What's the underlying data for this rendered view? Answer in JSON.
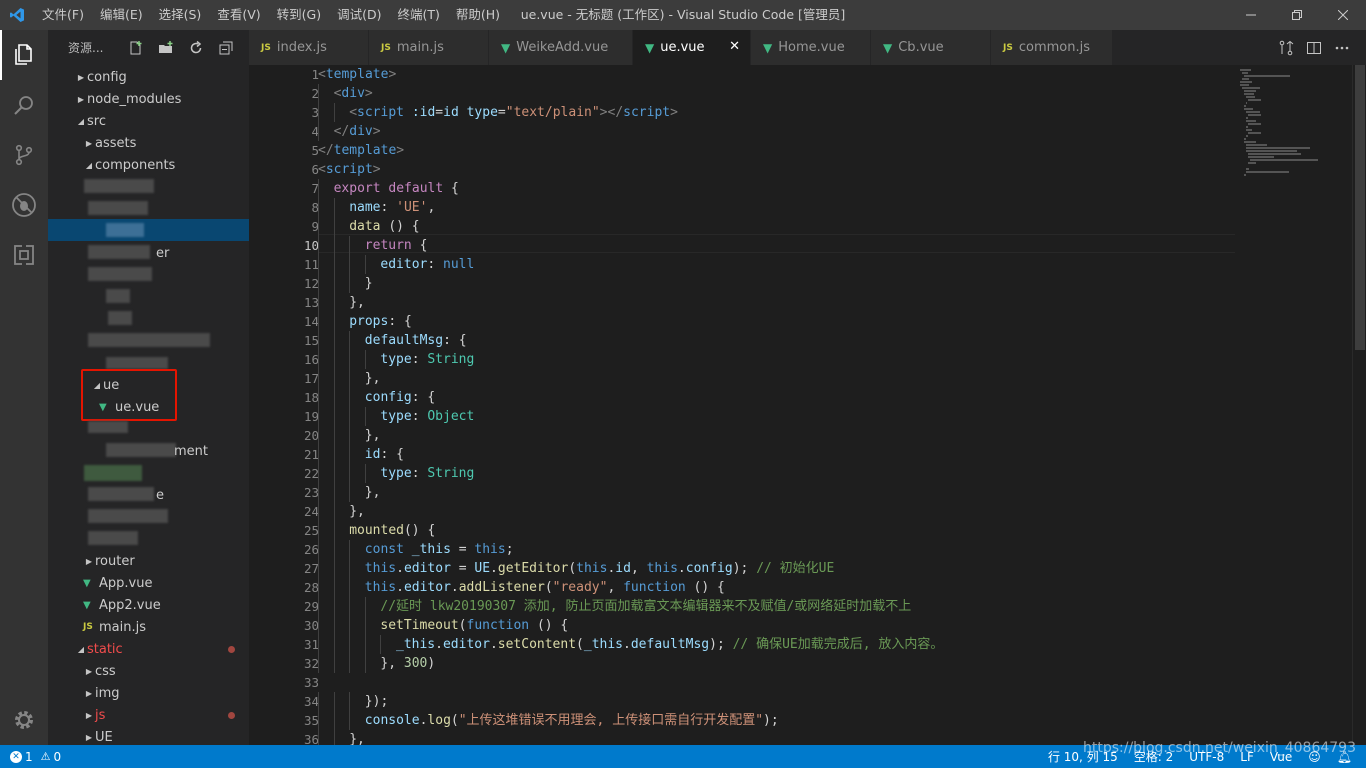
{
  "titlebar": {
    "title": "ue.vue - 无标题 (工作区) - Visual Studio Code [管理员]",
    "menus": [
      "文件(F)",
      "编辑(E)",
      "选择(S)",
      "查看(V)",
      "转到(G)",
      "调试(D)",
      "终端(T)",
      "帮助(H)"
    ]
  },
  "sidebar": {
    "title": "资源...",
    "tree": [
      {
        "label": "config",
        "type": "folder",
        "open": false
      },
      {
        "label": "node_modules",
        "type": "folder",
        "open": false
      },
      {
        "label": "src",
        "type": "folder",
        "open": true
      },
      {
        "label": "assets",
        "type": "folder",
        "open": false
      },
      {
        "label": "components",
        "type": "folder",
        "open": true
      },
      {
        "label": "ue",
        "type": "folder",
        "open": true
      },
      {
        "label": "ue.vue",
        "type": "vue"
      },
      {
        "label": "router",
        "type": "folder",
        "open": false
      },
      {
        "label": "App.vue",
        "type": "vue"
      },
      {
        "label": "App2.vue",
        "type": "vue"
      },
      {
        "label": "main.js",
        "type": "js"
      },
      {
        "label": "static",
        "type": "folder",
        "open": true,
        "modified": true
      },
      {
        "label": "css",
        "type": "folder",
        "open": false
      },
      {
        "label": "img",
        "type": "folder",
        "open": false
      },
      {
        "label": "js",
        "type": "folder",
        "open": false,
        "modified": true
      },
      {
        "label": "UE",
        "type": "folder",
        "open": false
      }
    ],
    "blur_fragments": [
      "er",
      "ment",
      "e"
    ]
  },
  "tabs": [
    {
      "label": "index.js",
      "type": "js",
      "active": false
    },
    {
      "label": "main.js",
      "type": "js",
      "active": false
    },
    {
      "label": "WeikeAdd.vue",
      "type": "vue",
      "active": false
    },
    {
      "label": "ue.vue",
      "type": "vue",
      "active": true
    },
    {
      "label": "Home.vue",
      "type": "vue",
      "active": false
    },
    {
      "label": "Cb.vue",
      "type": "vue",
      "active": false
    },
    {
      "label": "common.js",
      "type": "js",
      "active": false
    }
  ],
  "editor": {
    "current_line": 10,
    "lines": [
      {
        "n": 1,
        "i": 0,
        "t": [
          [
            "t-punc",
            "<"
          ],
          [
            "t-tag",
            "template"
          ],
          [
            "t-punc",
            ">"
          ]
        ]
      },
      {
        "n": 2,
        "i": 1,
        "t": [
          [
            "t-punc",
            "<"
          ],
          [
            "t-tag",
            "div"
          ],
          [
            "t-punc",
            ">"
          ]
        ]
      },
      {
        "n": 3,
        "i": 2,
        "t": [
          [
            "t-punc",
            "<"
          ],
          [
            "t-tag",
            "script"
          ],
          [
            "t-plain",
            " "
          ],
          [
            "t-attr",
            ":id"
          ],
          [
            "t-plain",
            "="
          ],
          [
            "t-attr",
            "id"
          ],
          [
            "t-plain",
            " "
          ],
          [
            "t-attr",
            "type"
          ],
          [
            "t-plain",
            "="
          ],
          [
            "t-str",
            "\"text/plain\""
          ],
          [
            "t-punc",
            "></"
          ],
          [
            "t-tag",
            "script"
          ],
          [
            "t-punc",
            ">"
          ]
        ]
      },
      {
        "n": 4,
        "i": 1,
        "t": [
          [
            "t-punc",
            "</"
          ],
          [
            "t-tag",
            "div"
          ],
          [
            "t-punc",
            ">"
          ]
        ]
      },
      {
        "n": 5,
        "i": 0,
        "t": [
          [
            "t-punc",
            "</"
          ],
          [
            "t-tag",
            "template"
          ],
          [
            "t-punc",
            ">"
          ]
        ]
      },
      {
        "n": 6,
        "i": 0,
        "t": [
          [
            "t-punc",
            "<"
          ],
          [
            "t-tag",
            "script"
          ],
          [
            "t-punc",
            ">"
          ]
        ]
      },
      {
        "n": 7,
        "i": 1,
        "t": [
          [
            "t-kw",
            "export"
          ],
          [
            "t-plain",
            " "
          ],
          [
            "t-kw",
            "default"
          ],
          [
            "t-plain",
            " {"
          ]
        ]
      },
      {
        "n": 8,
        "i": 2,
        "t": [
          [
            "t-prop",
            "name"
          ],
          [
            "t-plain",
            ": "
          ],
          [
            "t-str",
            "'UE'"
          ],
          [
            "t-plain",
            ","
          ]
        ]
      },
      {
        "n": 9,
        "i": 2,
        "t": [
          [
            "t-fn",
            "data"
          ],
          [
            "t-plain",
            " () {"
          ]
        ]
      },
      {
        "n": 10,
        "i": 3,
        "t": [
          [
            "t-kw",
            "return"
          ],
          [
            "t-plain",
            " {"
          ]
        ]
      },
      {
        "n": 11,
        "i": 4,
        "t": [
          [
            "t-prop",
            "editor"
          ],
          [
            "t-plain",
            ": "
          ],
          [
            "t-key",
            "null"
          ]
        ]
      },
      {
        "n": 12,
        "i": 3,
        "t": [
          [
            "t-plain",
            "}"
          ]
        ]
      },
      {
        "n": 13,
        "i": 2,
        "t": [
          [
            "t-plain",
            "},"
          ]
        ]
      },
      {
        "n": 14,
        "i": 2,
        "t": [
          [
            "t-prop",
            "props"
          ],
          [
            "t-plain",
            ": {"
          ]
        ]
      },
      {
        "n": 15,
        "i": 3,
        "t": [
          [
            "t-prop",
            "defaultMsg"
          ],
          [
            "t-plain",
            ": {"
          ]
        ]
      },
      {
        "n": 16,
        "i": 4,
        "t": [
          [
            "t-prop",
            "type"
          ],
          [
            "t-plain",
            ": "
          ],
          [
            "t-cls",
            "String"
          ]
        ]
      },
      {
        "n": 17,
        "i": 3,
        "t": [
          [
            "t-plain",
            "},"
          ]
        ]
      },
      {
        "n": 18,
        "i": 3,
        "t": [
          [
            "t-prop",
            "config"
          ],
          [
            "t-plain",
            ": {"
          ]
        ]
      },
      {
        "n": 19,
        "i": 4,
        "t": [
          [
            "t-prop",
            "type"
          ],
          [
            "t-plain",
            ": "
          ],
          [
            "t-cls",
            "Object"
          ]
        ]
      },
      {
        "n": 20,
        "i": 3,
        "t": [
          [
            "t-plain",
            "},"
          ]
        ]
      },
      {
        "n": 21,
        "i": 3,
        "t": [
          [
            "t-prop",
            "id"
          ],
          [
            "t-plain",
            ": {"
          ]
        ]
      },
      {
        "n": 22,
        "i": 4,
        "t": [
          [
            "t-prop",
            "type"
          ],
          [
            "t-plain",
            ": "
          ],
          [
            "t-cls",
            "String"
          ]
        ]
      },
      {
        "n": 23,
        "i": 3,
        "t": [
          [
            "t-plain",
            "},"
          ]
        ]
      },
      {
        "n": 24,
        "i": 2,
        "t": [
          [
            "t-plain",
            "},"
          ]
        ]
      },
      {
        "n": 25,
        "i": 2,
        "t": [
          [
            "t-fn",
            "mounted"
          ],
          [
            "t-plain",
            "() {"
          ]
        ]
      },
      {
        "n": 26,
        "i": 3,
        "t": [
          [
            "t-key",
            "const"
          ],
          [
            "t-plain",
            " "
          ],
          [
            "t-prop",
            "_this"
          ],
          [
            "t-plain",
            " = "
          ],
          [
            "t-key",
            "this"
          ],
          [
            "t-plain",
            ";"
          ]
        ]
      },
      {
        "n": 27,
        "i": 3,
        "t": [
          [
            "t-key",
            "this"
          ],
          [
            "t-plain",
            "."
          ],
          [
            "t-prop",
            "editor"
          ],
          [
            "t-plain",
            " = "
          ],
          [
            "t-prop",
            "UE"
          ],
          [
            "t-plain",
            "."
          ],
          [
            "t-fn",
            "getEditor"
          ],
          [
            "t-plain",
            "("
          ],
          [
            "t-key",
            "this"
          ],
          [
            "t-plain",
            "."
          ],
          [
            "t-prop",
            "id"
          ],
          [
            "t-plain",
            ", "
          ],
          [
            "t-key",
            "this"
          ],
          [
            "t-plain",
            "."
          ],
          [
            "t-prop",
            "config"
          ],
          [
            "t-plain",
            "); "
          ],
          [
            "t-cmt",
            "// 初始化UE"
          ]
        ]
      },
      {
        "n": 28,
        "i": 3,
        "t": [
          [
            "t-key",
            "this"
          ],
          [
            "t-plain",
            "."
          ],
          [
            "t-prop",
            "editor"
          ],
          [
            "t-plain",
            "."
          ],
          [
            "t-fn",
            "addListener"
          ],
          [
            "t-plain",
            "("
          ],
          [
            "t-str",
            "\"ready\""
          ],
          [
            "t-plain",
            ", "
          ],
          [
            "t-key",
            "function"
          ],
          [
            "t-plain",
            " () {"
          ]
        ]
      },
      {
        "n": 29,
        "i": 4,
        "t": [
          [
            "t-cmt",
            "//延时 lkw20190307 添加, 防止页面加载富文本编辑器来不及赋值/或网络延时加载不上"
          ]
        ]
      },
      {
        "n": 30,
        "i": 4,
        "t": [
          [
            "t-fn",
            "setTimeout"
          ],
          [
            "t-plain",
            "("
          ],
          [
            "t-key",
            "function"
          ],
          [
            "t-plain",
            " () {"
          ]
        ]
      },
      {
        "n": 31,
        "i": 5,
        "t": [
          [
            "t-prop",
            "_this"
          ],
          [
            "t-plain",
            "."
          ],
          [
            "t-prop",
            "editor"
          ],
          [
            "t-plain",
            "."
          ],
          [
            "t-fn",
            "setContent"
          ],
          [
            "t-plain",
            "("
          ],
          [
            "t-prop",
            "_this"
          ],
          [
            "t-plain",
            "."
          ],
          [
            "t-prop",
            "defaultMsg"
          ],
          [
            "t-plain",
            "); "
          ],
          [
            "t-cmt",
            "// 确保UE加载完成后, 放入内容。"
          ]
        ]
      },
      {
        "n": 32,
        "i": 4,
        "t": [
          [
            "t-plain",
            "}, "
          ],
          [
            "t-num",
            "300"
          ],
          [
            "t-plain",
            ")"
          ]
        ]
      },
      {
        "n": 33,
        "i": 0,
        "t": []
      },
      {
        "n": 34,
        "i": 3,
        "t": [
          [
            "t-plain",
            "});"
          ]
        ]
      },
      {
        "n": 35,
        "i": 3,
        "t": [
          [
            "t-prop",
            "console"
          ],
          [
            "t-plain",
            "."
          ],
          [
            "t-fn",
            "log"
          ],
          [
            "t-plain",
            "("
          ],
          [
            "t-str",
            "\"上传这堆错误不用理会, 上传接口需自行开发配置\""
          ],
          [
            "t-plain",
            ");"
          ]
        ]
      },
      {
        "n": 36,
        "i": 2,
        "t": [
          [
            "t-plain",
            "},"
          ]
        ]
      }
    ]
  },
  "statusbar": {
    "errors": "1",
    "warnings": "0",
    "position": "行 10, 列 15",
    "spaces": "空格: 2",
    "encoding": "UTF-8",
    "eol": "LF",
    "language": "Vue",
    "watermark": "https://blog.csdn.net/weixin_40864793"
  },
  "colors": {
    "accent": "#007acc",
    "selection": "#094771",
    "highlight_box": "#e51400"
  }
}
